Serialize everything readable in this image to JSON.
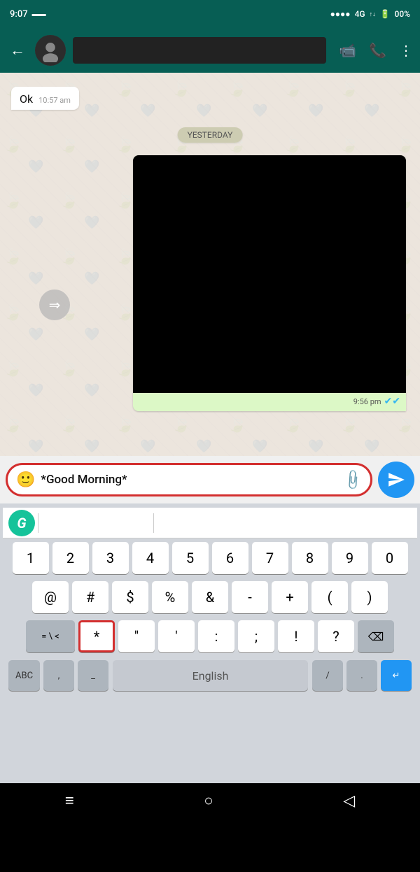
{
  "statusBar": {
    "time": "9:07",
    "signal": "4G",
    "battery": "00%",
    "icons": [
      "signal-bars",
      "4g-icon",
      "battery-icon"
    ]
  },
  "header": {
    "backLabel": "←",
    "contactName": "",
    "icons": [
      "video-call",
      "voice-call",
      "more-options"
    ]
  },
  "chat": {
    "messageSent": "Ok",
    "messageSentTime": "10:57 am",
    "yesterdayLabel": "YESTERDAY",
    "videoTime": "9:56 pm",
    "forwardIcon": "⇒"
  },
  "inputBar": {
    "emojiIcon": "🙂",
    "inputText": "*Good Morning*",
    "attachIcon": "📎",
    "sendIcon": "send"
  },
  "keyboard": {
    "grammarlyLabel": "G",
    "row1": [
      "1",
      "2",
      "3",
      "4",
      "5",
      "6",
      "7",
      "8",
      "9",
      "0"
    ],
    "row2": [
      "@",
      "#",
      "$",
      "%",
      "&",
      "-",
      "+",
      "(",
      ")"
    ],
    "row3Special": [
      "=\\<",
      "*",
      "\"",
      "'",
      ":",
      ";",
      " !",
      "?"
    ],
    "row3Keys": [
      "=\\<",
      "*",
      "\"",
      "'",
      ":",
      ";",
      "!",
      "?"
    ],
    "backspaceIcon": "⌫",
    "bottomRow": {
      "abcLabel": "ABC",
      "comma": ",",
      "underscore": "_",
      "languageLabel": "English",
      "slash": "/",
      "period": ".",
      "enterIcon": "↵"
    }
  },
  "navBar": {
    "homeIcon": "≡",
    "circleIcon": "○",
    "backIcon": "◁"
  }
}
